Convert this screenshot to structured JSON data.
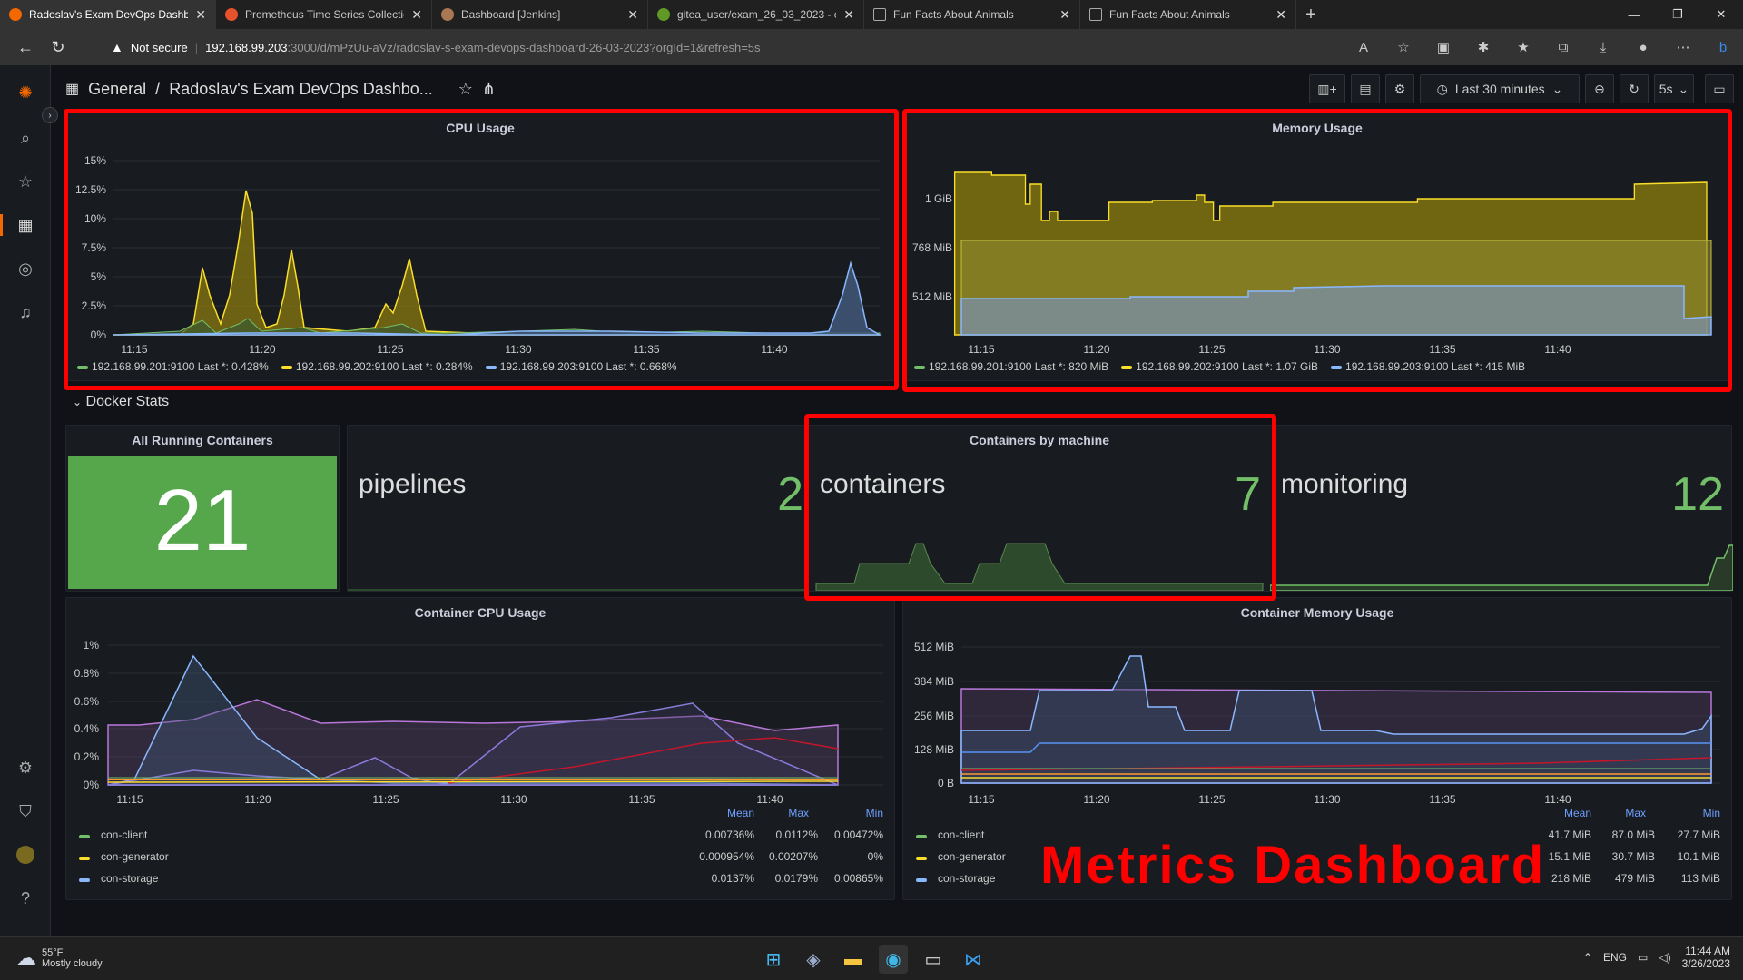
{
  "browser": {
    "tabs": [
      {
        "title": "Radoslav's Exam DevOps Dashbo",
        "active": true
      },
      {
        "title": "Prometheus Time Series Collectio",
        "active": false
      },
      {
        "title": "Dashboard [Jenkins]",
        "active": false
      },
      {
        "title": "gitea_user/exam_26_03_2023 - e",
        "active": false
      },
      {
        "title": "Fun Facts About Animals",
        "active": false
      },
      {
        "title": "Fun Facts About Animals",
        "active": false
      }
    ],
    "not_secure": "Not secure",
    "url_host": "192.168.99.203",
    "url_path": ":3000/d/mPzUu-aVz/radoslav-s-exam-devops-dashboard-26-03-2023?orgId=1&refresh=5s"
  },
  "dashboard": {
    "breadcrumb_root": "General",
    "breadcrumb_sep": "/",
    "title": "Radoslav's Exam DevOps Dashbo...",
    "time_range": "Last 30 minutes",
    "refresh": "5s"
  },
  "row_title": "Docker Stats",
  "panels": {
    "cpu_usage": {
      "title": "CPU Usage",
      "legend": [
        {
          "host": "192.168.99.201:9100",
          "last": "Last *: 0.428%",
          "color": "#73bf69"
        },
        {
          "host": "192.168.99.202:9100",
          "last": "Last *: 0.284%",
          "color": "#fade2a"
        },
        {
          "host": "192.168.99.203:9100",
          "last": "Last *: 0.668%",
          "color": "#8ab8ff"
        }
      ]
    },
    "memory_usage": {
      "title": "Memory Usage",
      "legend": [
        {
          "host": "192.168.99.201:9100",
          "last": "Last *: 820 MiB",
          "color": "#73bf69"
        },
        {
          "host": "192.168.99.202:9100",
          "last": "Last *: 1.07 GiB",
          "color": "#fade2a"
        },
        {
          "host": "192.168.99.203:9100",
          "last": "Last *: 415 MiB",
          "color": "#8ab8ff"
        }
      ]
    },
    "all_running": {
      "title": "All Running Containers",
      "value": "21"
    },
    "containers_by_machine": {
      "title": "Containers by machine",
      "stats": [
        {
          "label": "pipelines",
          "value": "2"
        },
        {
          "label": "containers",
          "value": "7"
        },
        {
          "label": "monitoring",
          "value": "12"
        }
      ]
    },
    "container_cpu": {
      "title": "Container CPU Usage",
      "headers": {
        "mean": "Mean",
        "max": "Max",
        "min": "Min"
      },
      "rows": [
        {
          "name": "con-client",
          "mean": "0.00736%",
          "max": "0.0112%",
          "min": "0.00472%",
          "color": "#73bf69"
        },
        {
          "name": "con-generator",
          "mean": "0.000954%",
          "max": "0.00207%",
          "min": "0%",
          "color": "#fade2a"
        },
        {
          "name": "con-storage",
          "mean": "0.0137%",
          "max": "0.0179%",
          "min": "0.00865%",
          "color": "#8ab8ff"
        }
      ]
    },
    "container_memory": {
      "title": "Container Memory Usage",
      "headers": {
        "mean": "Mean",
        "max": "Max",
        "min": "Min"
      },
      "rows": [
        {
          "name": "con-client",
          "mean": "41.7 MiB",
          "max": "87.0 MiB",
          "min": "27.7 MiB",
          "color": "#73bf69"
        },
        {
          "name": "con-generator",
          "mean": "15.1 MiB",
          "max": "30.7 MiB",
          "min": "10.1 MiB",
          "color": "#fade2a"
        },
        {
          "name": "con-storage",
          "mean": "218 MiB",
          "max": "479 MiB",
          "min": "113 MiB",
          "color": "#8ab8ff"
        }
      ]
    }
  },
  "overlay_label": "Metrics Dashboard",
  "chart_data": [
    {
      "type": "area",
      "title": "CPU Usage",
      "x": [
        "11:15",
        "11:20",
        "11:25",
        "11:30",
        "11:35",
        "11:40"
      ],
      "yticks": [
        "15%",
        "12.5%",
        "10%",
        "7.5%",
        "5%",
        "2.5%",
        "0%"
      ],
      "ylim": [
        0,
        15
      ],
      "series": [
        {
          "name": "192.168.99.201:9100",
          "values": [
            0.4,
            0.5,
            0.4,
            0.3,
            0.4,
            0.4
          ],
          "color": "#73bf69"
        },
        {
          "name": "192.168.99.202:9100",
          "values": [
            0.3,
            12.5,
            2.0,
            0.3,
            0.3,
            0.3
          ],
          "color": "#fade2a"
        },
        {
          "name": "192.168.99.203:9100",
          "values": [
            0.4,
            0.3,
            0.3,
            0.4,
            0.5,
            7.5
          ],
          "color": "#8ab8ff"
        }
      ]
    },
    {
      "type": "area",
      "title": "Memory Usage",
      "x": [
        "11:15",
        "11:20",
        "11:25",
        "11:30",
        "11:35",
        "11:40"
      ],
      "yticks": [
        "1 GiB",
        "768 MiB",
        "512 MiB"
      ],
      "series": [
        {
          "name": "192.168.99.201:9100",
          "values": [
            820,
            820,
            820,
            820,
            820,
            820
          ],
          "unit": "MiB",
          "color": "#73bf69"
        },
        {
          "name": "192.168.99.202:9100",
          "values": [
            1.1,
            0.95,
            1.0,
            1.02,
            1.07,
            1.07
          ],
          "unit": "GiB",
          "color": "#fade2a"
        },
        {
          "name": "192.168.99.203:9100",
          "values": [
            380,
            380,
            390,
            410,
            420,
            415
          ],
          "unit": "MiB",
          "color": "#8ab8ff"
        }
      ]
    },
    {
      "type": "line",
      "title": "Container CPU Usage",
      "x": [
        "11:15",
        "11:20",
        "11:25",
        "11:30",
        "11:35",
        "11:40"
      ],
      "yticks": [
        "1%",
        "0.8%",
        "0.6%",
        "0.4%",
        "0.2%",
        "0%"
      ],
      "ylim": [
        0,
        1
      ]
    },
    {
      "type": "line",
      "title": "Container Memory Usage",
      "x": [
        "11:15",
        "11:20",
        "11:25",
        "11:30",
        "11:35",
        "11:40"
      ],
      "yticks": [
        "512 MiB",
        "384 MiB",
        "256 MiB",
        "128 MiB",
        "0 B"
      ],
      "ylim": [
        0,
        512
      ]
    }
  ],
  "taskbar": {
    "temp": "55°F",
    "weather": "Mostly cloudy",
    "lang": "ENG",
    "time": "11:44 AM",
    "date": "3/26/2023"
  }
}
